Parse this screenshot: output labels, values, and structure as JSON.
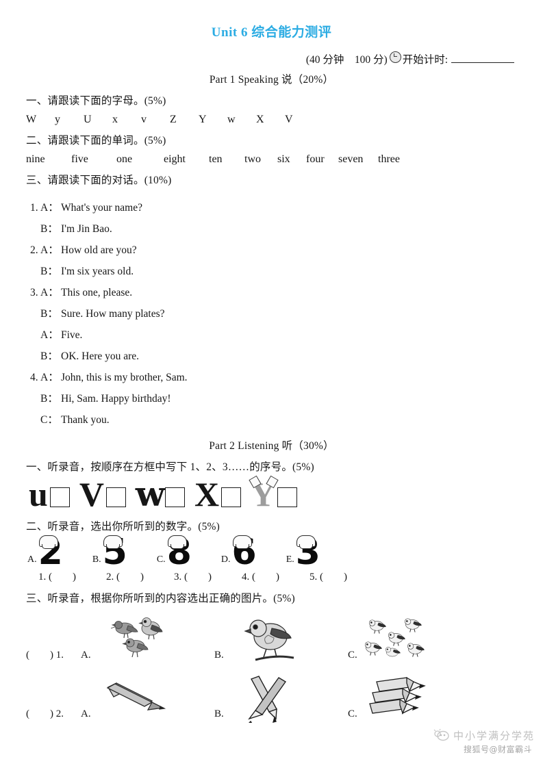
{
  "header": {
    "title": "Unit 6 综合能力测评",
    "meta_paren": "(40 分钟    100 分)",
    "meta_start_label": "开始计时:",
    "clock_icon": "clock-icon",
    "title_color": "#2CACE3"
  },
  "part1": {
    "heading": "Part 1 Speaking 说（20%）",
    "q1": {
      "prompt": "一、请跟读下面的字母。(5%)",
      "letters": [
        "W",
        "y",
        "U",
        "x",
        "v",
        "Z",
        "Y",
        "w",
        "X",
        "V"
      ]
    },
    "q2": {
      "prompt": "二、请跟读下面的单词。(5%)",
      "words": [
        "nine",
        "five",
        "one",
        "eight",
        "ten",
        "two",
        "six",
        "four",
        "seven",
        "three"
      ]
    },
    "q3": {
      "prompt": "三、请跟读下面的对话。(10%)",
      "dialogues": [
        {
          "num": "1.",
          "speaker": "A：",
          "text": "What's your name?"
        },
        {
          "num": "",
          "speaker": "B：",
          "text": "I'm Jin Bao."
        },
        {
          "num": "2.",
          "speaker": "A：",
          "text": "How old are you?"
        },
        {
          "num": "",
          "speaker": "B：",
          "text": "I'm six years old."
        },
        {
          "num": "3.",
          "speaker": "A：",
          "text": "This one, please."
        },
        {
          "num": "",
          "speaker": "B：",
          "text": "Sure. How many plates?"
        },
        {
          "num": "",
          "speaker": "A：",
          "text": "Five."
        },
        {
          "num": "",
          "speaker": "B：",
          "text": "OK. Here you are."
        },
        {
          "num": "4.",
          "speaker": "A：",
          "text": "John, this is my brother, Sam."
        },
        {
          "num": "",
          "speaker": "B：",
          "text": "Hi, Sam. Happy birthday!"
        },
        {
          "num": "",
          "speaker": "C：",
          "text": "Thank you."
        }
      ]
    }
  },
  "part2": {
    "heading": "Part 2 Listening 听（30%）",
    "q1": {
      "prompt": "一、听录音，按顺序在方框中写下 1、2、3……的序号。(5%)",
      "letters": [
        {
          "glyph": "u",
          "style": "plain"
        },
        {
          "glyph": "V",
          "style": "plain"
        },
        {
          "glyph": "w",
          "style": "fancy"
        },
        {
          "glyph": "X",
          "style": "plain"
        },
        {
          "glyph": "Y",
          "style": "pencil"
        }
      ]
    },
    "q2": {
      "prompt": "二、听录音，选出你所听到的数字。(5%)",
      "options": [
        {
          "label": "A.",
          "digit": "2"
        },
        {
          "label": "B.",
          "digit": "5"
        },
        {
          "label": "C.",
          "digit": "8"
        },
        {
          "label": "D.",
          "digit": "6"
        },
        {
          "label": "E.",
          "digit": "3"
        }
      ],
      "answer_blanks": [
        "1. (        )",
        "2. (        )",
        "3. (        )",
        "4. (        )",
        "5. (        )"
      ]
    },
    "q3": {
      "prompt": "三、听录音，根据你所听到的内容选出正确的图片。(5%)",
      "rows": [
        {
          "lead": "(        ) 1.",
          "options": [
            {
              "label": "A.",
              "art": "three-birds-icon"
            },
            {
              "label": "B.",
              "art": "one-bird-icon"
            },
            {
              "label": "C.",
              "art": "many-birds-icon"
            }
          ]
        },
        {
          "lead": "(        ) 2.",
          "options": [
            {
              "label": "A.",
              "art": "one-pencil-icon"
            },
            {
              "label": "B.",
              "art": "two-pencils-icon"
            },
            {
              "label": "C.",
              "art": "three-pencils-icon"
            }
          ]
        }
      ]
    }
  },
  "watermark": {
    "line1": "中小学满分学苑",
    "line2": "搜狐号@财富霸斗"
  }
}
